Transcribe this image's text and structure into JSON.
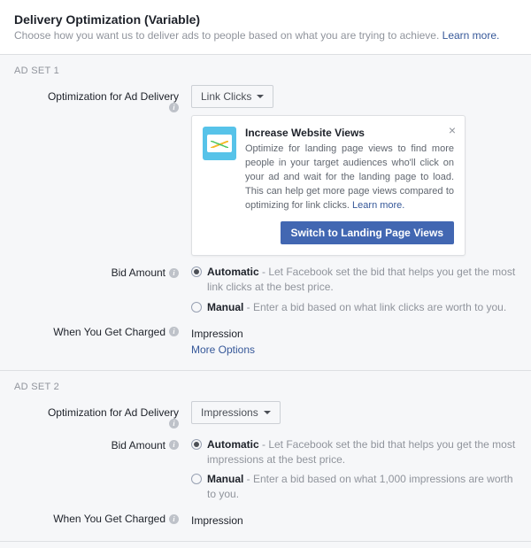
{
  "header": {
    "title": "Delivery Optimization (Variable)",
    "subtitle": "Choose how you want us to deliver ads to people based on what you are trying to achieve. ",
    "learn_more": "Learn more."
  },
  "labels": {
    "optimization": "Optimization for Ad Delivery",
    "bid_amount": "Bid Amount",
    "when_charged": "When You Get Charged"
  },
  "adset1": {
    "title": "AD SET 1",
    "dropdown_value": "Link Clicks",
    "callout": {
      "title": "Increase Website Views",
      "desc": "Optimize for landing page views to find more people in your target audiences who'll click on your ad and wait for the landing page to load. This can help get more page views compared to optimizing for link clicks. ",
      "learn_more": "Learn more.",
      "cta": "Switch to Landing Page Views"
    },
    "bid": {
      "auto_label": "Automatic",
      "auto_desc": " - Let Facebook set the bid that helps you get the most link clicks at the best price.",
      "manual_label": "Manual",
      "manual_desc": " - Enter a bid based on what link clicks are worth to you."
    },
    "charged_value": "Impression",
    "more_options": "More Options"
  },
  "adset2": {
    "title": "AD SET 2",
    "dropdown_value": "Impressions",
    "bid": {
      "auto_label": "Automatic",
      "auto_desc": " - Let Facebook set the bid that helps you get the most impressions at the best price.",
      "manual_label": "Manual",
      "manual_desc": " - Enter a bid based on what 1,000 impressions are worth to you."
    },
    "charged_value": "Impression"
  }
}
